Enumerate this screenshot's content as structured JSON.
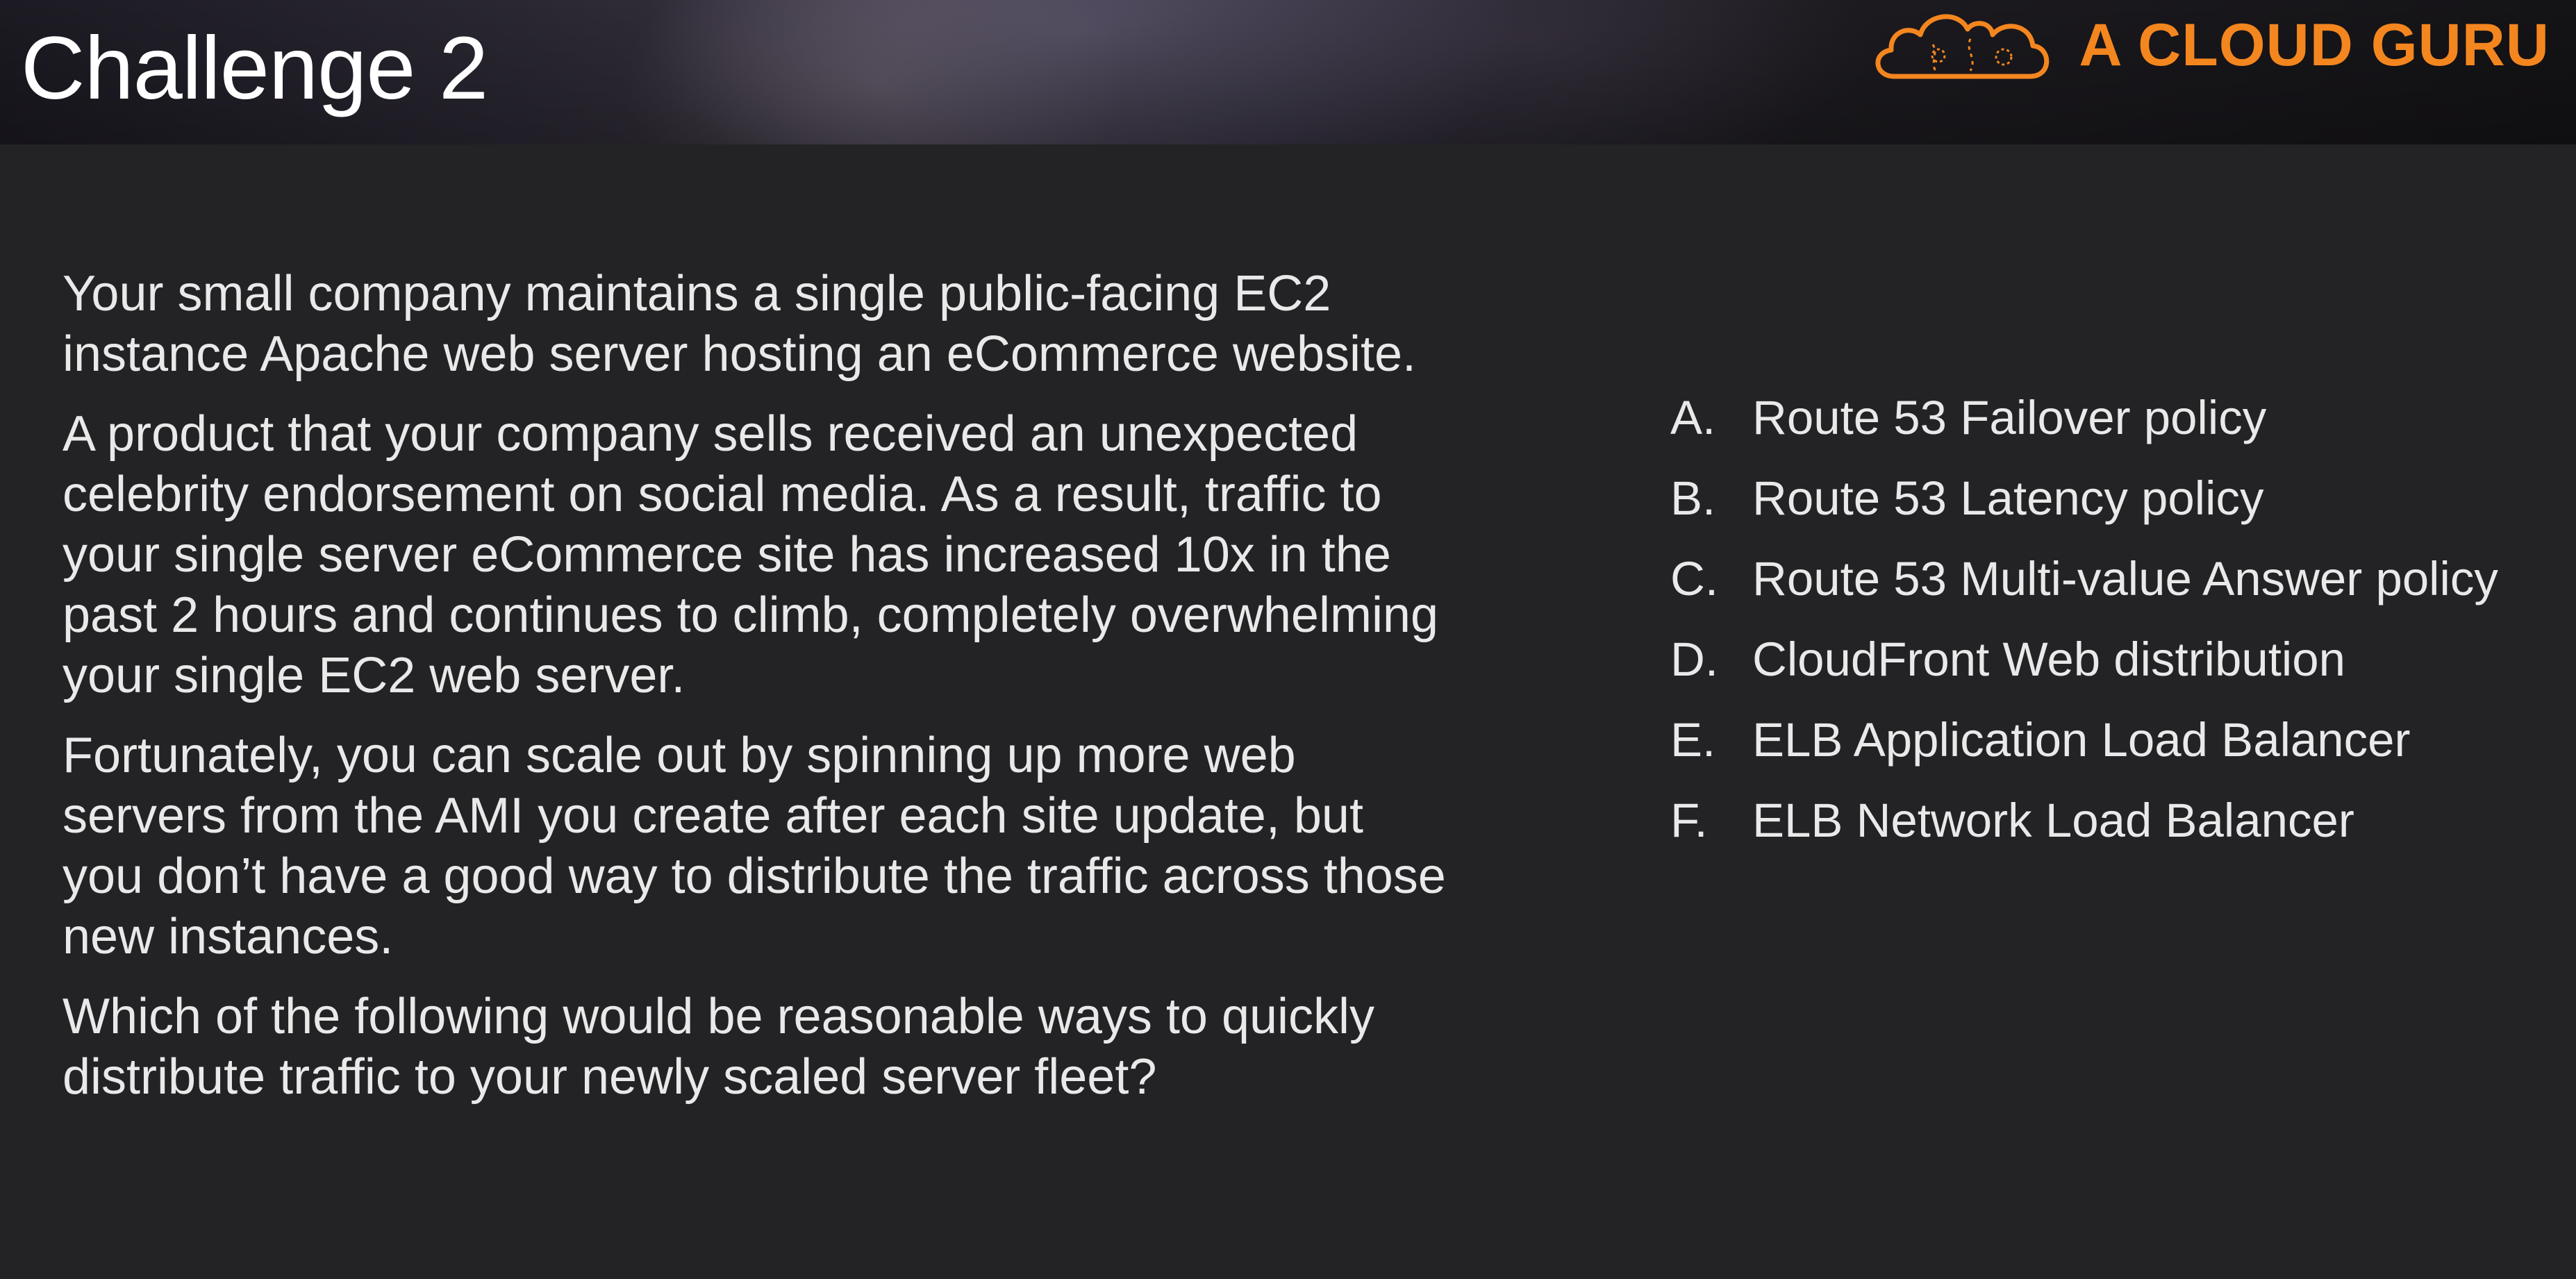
{
  "slide": {
    "title": "Challenge 2"
  },
  "brand": {
    "name": "A CLOUD GURU",
    "logo_icon": "cloud-logo-icon",
    "color": "#f4861f"
  },
  "question": {
    "paragraphs": [
      "Your small company maintains a single public-facing EC2 instance Apache web server hosting an eCommerce website.",
      "A product that your company sells received an unexpected celebrity endorsement on social media.  As a result, traffic to your single server eCommerce site has increased 10x in the past 2 hours and continues to climb, completely overwhelming your single EC2 web server.",
      "Fortunately, you can scale out by spinning up more web servers from the AMI you create after each site update, but you don’t have a good way to distribute the traffic across those new instances.",
      "Which of the following would be reasonable ways to quickly distribute traffic to your newly scaled server fleet?"
    ]
  },
  "options": [
    {
      "letter": "A.",
      "text": "Route 53 Failover policy"
    },
    {
      "letter": "B.",
      "text": "Route 53 Latency policy"
    },
    {
      "letter": "C.",
      "text": "Route 53 Multi-value Answer policy"
    },
    {
      "letter": "D.",
      "text": "CloudFront Web distribution"
    },
    {
      "letter": "E.",
      "text": "ELB Application Load Balancer"
    },
    {
      "letter": "F.",
      "text": "ELB Network Load Balancer"
    }
  ]
}
